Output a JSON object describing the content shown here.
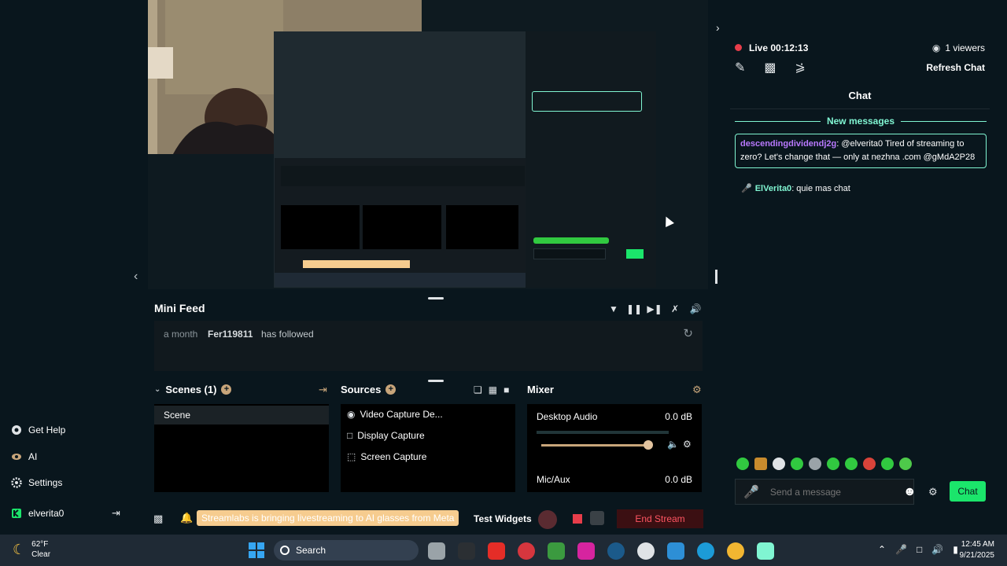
{
  "window": {
    "minimize_icon": "minimize-icon",
    "maximize_icon": "maximize-icon",
    "close_icon": "close-icon"
  },
  "sidebar": {
    "items": [
      {
        "label": "Get Help",
        "icon": "help-icon"
      },
      {
        "label": "AI",
        "icon": "eye-icon"
      },
      {
        "label": "Settings",
        "icon": "gear-icon"
      }
    ],
    "user": {
      "name": "elverita0",
      "icon": "kick-icon"
    }
  },
  "minifeed": {
    "title": "Mini Feed",
    "events": [
      {
        "time": "a month",
        "user": "Fer119811",
        "action": "has followed"
      }
    ]
  },
  "scenes": {
    "title": "Scenes (1)",
    "items": [
      "Scene"
    ]
  },
  "sources": {
    "title": "Sources",
    "items": [
      "Video Capture De...",
      "Display Capture",
      "Screen Capture"
    ]
  },
  "mixer": {
    "title": "Mixer",
    "channels": [
      {
        "name": "Desktop Audio",
        "level": "0.0 dB"
      },
      {
        "name": "Mic/Aux",
        "level": "0.0 dB"
      }
    ]
  },
  "bottombar": {
    "announcement": "Streamlabs is bringing livestreaming to AI glasses from Meta",
    "test_widgets": "Test Widgets",
    "end_stream": "End Stream"
  },
  "chat": {
    "live_label": "Live 00:12:13",
    "viewers": "1 viewers",
    "refresh": "Refresh Chat",
    "title": "Chat",
    "new_messages": "New messages",
    "messages": [
      {
        "user": "descendingdividendj2g",
        "sep": ":",
        "text": " @elverita0 Tired of streaming to zero? Let's change that — only at nezhna .com @gMdA2P28"
      },
      {
        "user": "ElVerita0",
        "sep": ":",
        "text": " quie mas chat"
      }
    ],
    "input_placeholder": "Send a message",
    "send_label": "Chat"
  },
  "taskbar": {
    "temp": "62°F",
    "condition": "Clear",
    "search": "Search",
    "time": "12:45 AM",
    "date": "9/21/2025"
  },
  "colors": {
    "accent_green": "#1be56b",
    "mint": "#80f5d2",
    "live_red": "#e73d4a",
    "username_purple": "#b979ff",
    "background": "#09161d"
  }
}
